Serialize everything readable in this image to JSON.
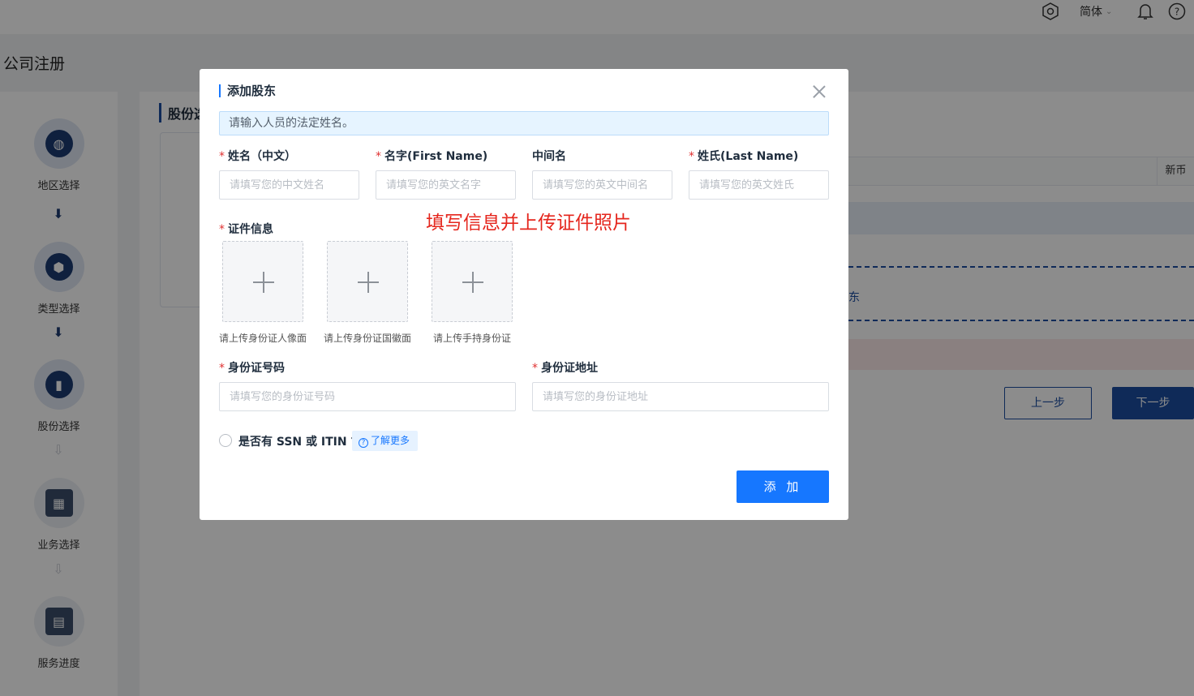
{
  "header": {
    "language": "简体"
  },
  "page": {
    "title": "公司注册",
    "section_title": "股份选",
    "table_header_currency": "新币",
    "dashed_row_text": "东",
    "prev_button": "上一步",
    "next_button": "下一步"
  },
  "steps": [
    {
      "label": "地区选择"
    },
    {
      "label": "类型选择"
    },
    {
      "label": "股份选择"
    },
    {
      "label": "业务选择"
    },
    {
      "label": "服务进度"
    }
  ],
  "modal": {
    "title": "添加股东",
    "info_text": "请输入人员的法定姓名。",
    "fields": {
      "chinese_name": {
        "label": "姓名（中文）",
        "placeholder": "请填写您的中文姓名",
        "required": true
      },
      "first_name": {
        "label": "名字(First Name)",
        "placeholder": "请填写您的英文名字",
        "required": true
      },
      "middle_name": {
        "label": "中间名",
        "placeholder": "请填写您的英文中间名",
        "required": false
      },
      "last_name": {
        "label": "姓氏(Last Name)",
        "placeholder": "请填写您的英文姓氏",
        "required": true
      },
      "id_info": {
        "label": "证件信息",
        "required": true
      },
      "id_number": {
        "label": "身份证号码",
        "placeholder": "请填写您的身份证号码",
        "required": true
      },
      "id_address": {
        "label": "身份证地址",
        "placeholder": "请填写您的身份证地址",
        "required": true
      }
    },
    "annotation": "填写信息并上传证件照片",
    "uploads": [
      {
        "caption": "请上传身份证人像面"
      },
      {
        "caption": "请上传身份证国徽面"
      },
      {
        "caption": "请上传手持身份证"
      }
    ],
    "ssn_question": "是否有 SSN 或 ITIN ?",
    "learn_more": "了解更多",
    "submit": "添 加",
    "required_mark": "*"
  },
  "colors": {
    "primary": "#1677ff",
    "navy": "#1d4ea1",
    "required": "#e03131",
    "annotation": "#e5261d"
  }
}
